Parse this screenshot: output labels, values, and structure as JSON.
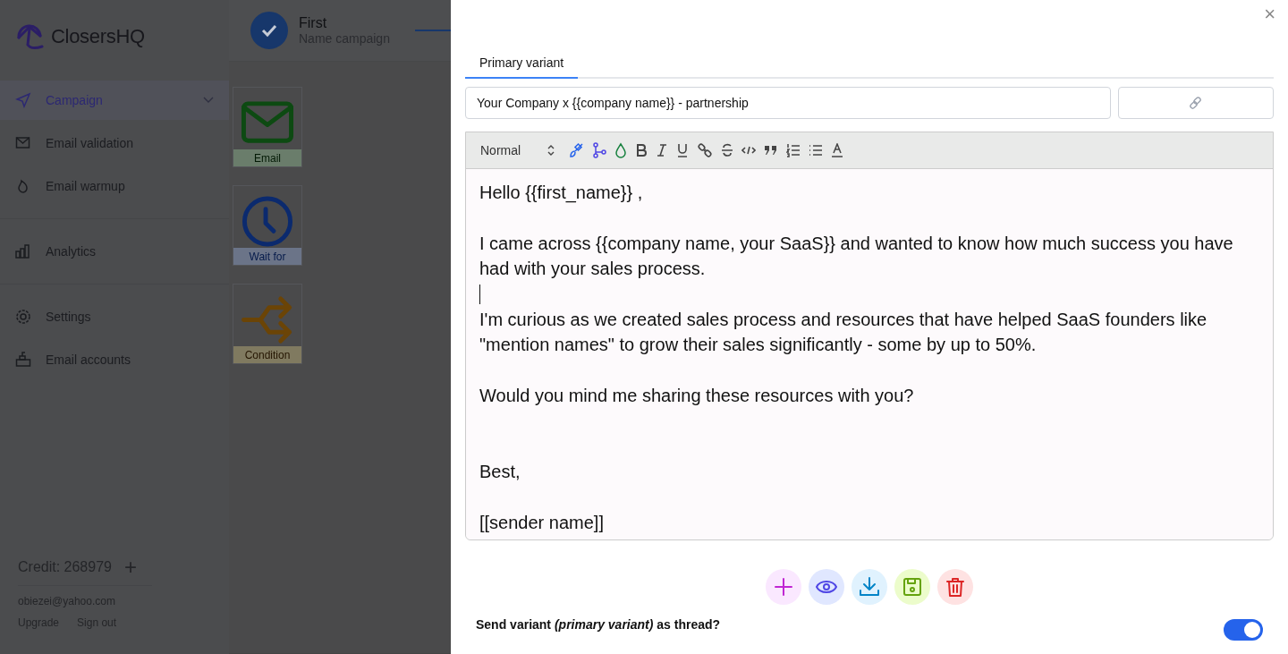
{
  "sidebar": {
    "logo": "ClosersHQ",
    "groups": [
      [
        {
          "label": "Campaign",
          "selected": true,
          "expandable": true
        },
        {
          "label": "Email validation",
          "selected": false,
          "expandable": false
        },
        {
          "label": "Email warmup",
          "selected": false,
          "expandable": false
        }
      ],
      [
        {
          "label": "Analytics",
          "selected": false,
          "expandable": false
        }
      ],
      [
        {
          "label": "Settings",
          "selected": false,
          "expandable": false
        },
        {
          "label": "Email accounts",
          "selected": false,
          "expandable": false
        }
      ]
    ],
    "credit": "Credit: 268979",
    "add": "+",
    "email": "obiezei@yahoo.com",
    "links": [
      "Upgrade",
      "Sign out"
    ]
  },
  "stepper": {
    "title": "First",
    "subtitle": "Name campaign",
    "completed": true
  },
  "nodes": [
    {
      "kind": "email",
      "label": "Email"
    },
    {
      "kind": "wait",
      "label": "Wait for"
    },
    {
      "kind": "condition",
      "label": "Condition"
    }
  ],
  "drawer": {
    "close": "×",
    "tabs": [
      {
        "label": "Primary variant",
        "selected": true
      }
    ],
    "subject": "Your Company x {{company name}} - partnership",
    "format": "Normal",
    "body": [
      {
        "kind": "text",
        "text": "Hello {{first_name}} ,"
      },
      {
        "kind": "blank"
      },
      {
        "kind": "text",
        "text": "I came across {{company name, your SaaS}} and wanted to know how much success you have had with your sales process."
      },
      {
        "kind": "caret"
      },
      {
        "kind": "text",
        "text": "I'm curious as we created sales process and resources that have helped SaaS founders like \"mention names\" to grow their sales significantly - some by up to 50%."
      },
      {
        "kind": "blank"
      },
      {
        "kind": "text",
        "text": "Would you mind me sharing these resources with you?"
      },
      {
        "kind": "blank"
      },
      {
        "kind": "blank"
      },
      {
        "kind": "text",
        "text": "Best,"
      },
      {
        "kind": "blank"
      },
      {
        "kind": "text",
        "text": "[[sender name]]"
      }
    ],
    "actions": [
      {
        "kind": "add"
      },
      {
        "kind": "preview"
      },
      {
        "kind": "download"
      },
      {
        "kind": "save"
      },
      {
        "kind": "delete"
      }
    ],
    "thread": {
      "question": "Send variant *(primary variant)* as thread?",
      "on": true
    }
  }
}
